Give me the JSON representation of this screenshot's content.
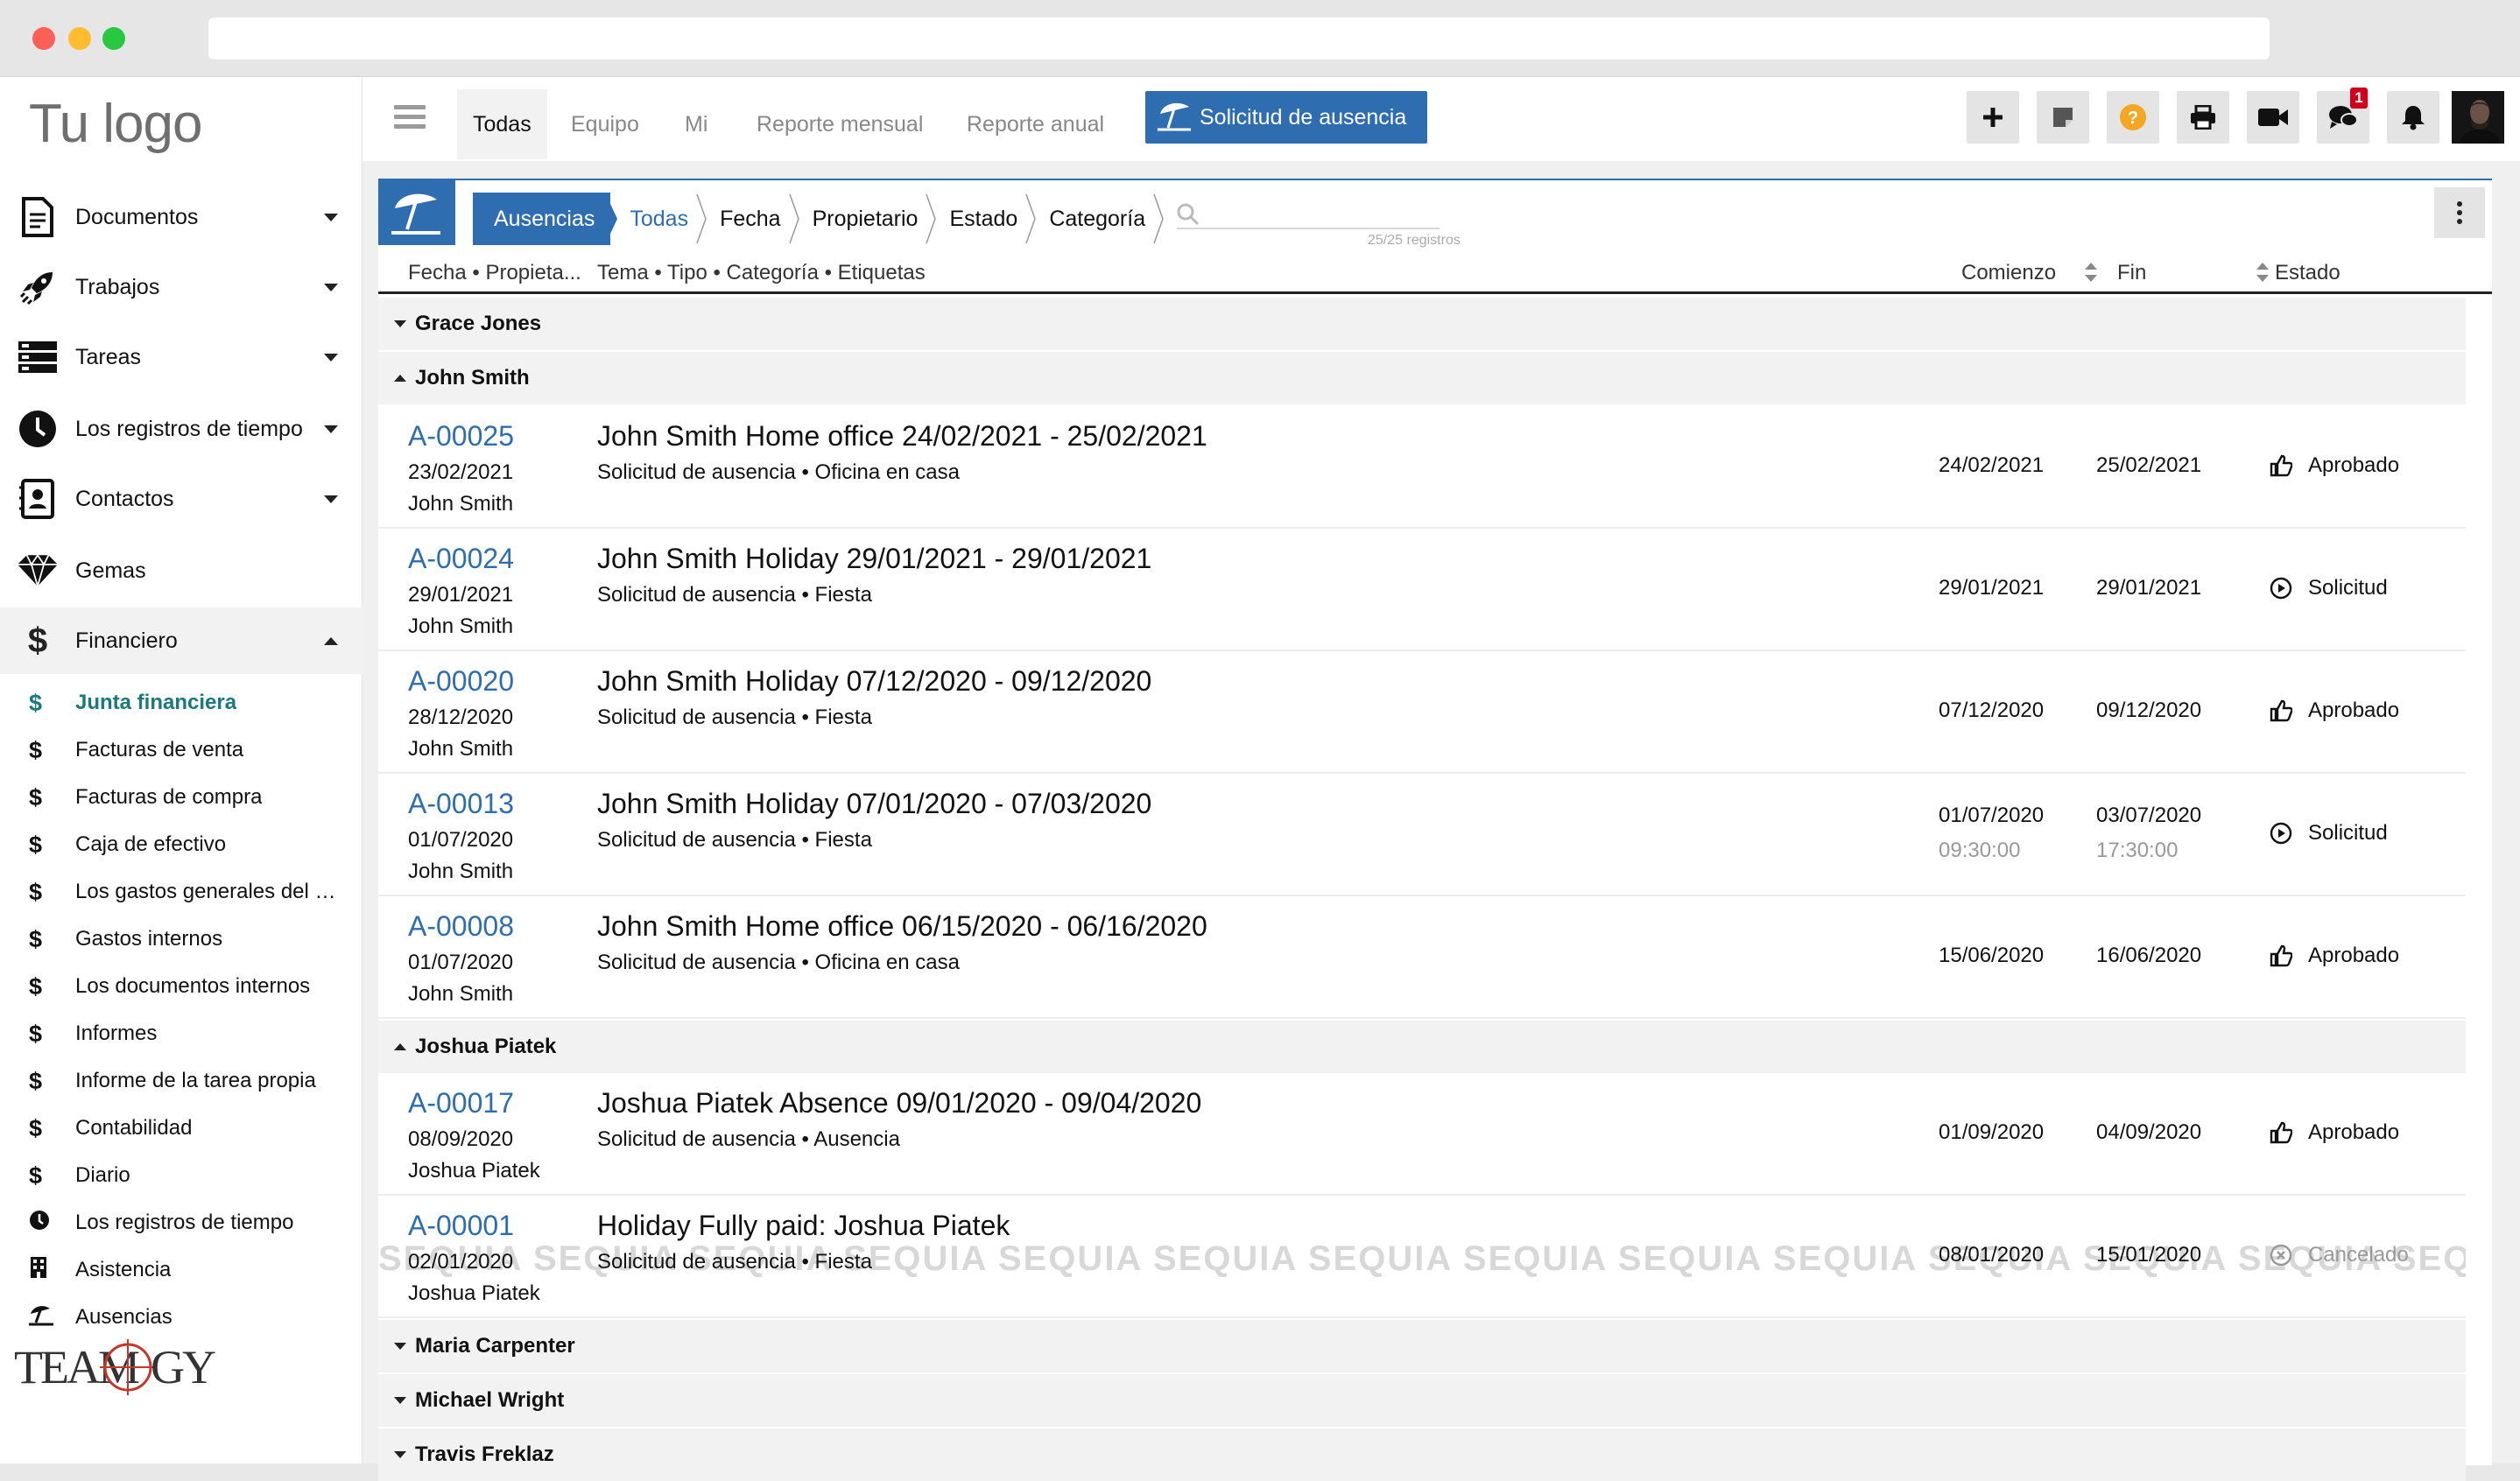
{
  "header": {
    "logo_text": "Tu logo"
  },
  "tabs": [
    {
      "label": "Todas",
      "active": true
    },
    {
      "label": "Equipo"
    },
    {
      "label": "Mi"
    },
    {
      "label": "Reporte mensual"
    },
    {
      "label": "Reporte anual"
    }
  ],
  "absence_button": "Solicitud de ausencia",
  "notification_badge": "1",
  "sidebar": {
    "items": [
      {
        "label": "Documentos"
      },
      {
        "label": "Trabajos"
      },
      {
        "label": "Tareas"
      },
      {
        "label": "Los registros de tiempo"
      },
      {
        "label": "Contactos"
      },
      {
        "label": "Gemas"
      },
      {
        "label": "Financiero"
      }
    ],
    "sub_items": [
      {
        "label": "Junta financiera"
      },
      {
        "label": "Facturas de venta"
      },
      {
        "label": "Facturas de compra"
      },
      {
        "label": "Caja de efectivo"
      },
      {
        "label": "Los gastos generales del …"
      },
      {
        "label": "Gastos internos"
      },
      {
        "label": "Los documentos internos"
      },
      {
        "label": "Informes"
      },
      {
        "label": "Informe de la tarea propia"
      },
      {
        "label": "Contabilidad"
      },
      {
        "label": "Diario"
      },
      {
        "label": "Los registros de tiempo"
      },
      {
        "label": "Asistencia"
      },
      {
        "label": "Ausencias"
      }
    ],
    "brand": "TEAMOGY"
  },
  "breadcrumb": [
    "Ausencias",
    "Todas",
    "Fecha",
    "Propietario",
    "Estado",
    "Categoría"
  ],
  "search": {
    "count": "25/25 registros"
  },
  "columns": {
    "left": "Fecha • Propieta...",
    "middle": "Tema • Tipo • Categoría • Etiquetas",
    "start": "Comienzo",
    "end": "Fin",
    "status": "Estado"
  },
  "groups": [
    {
      "name": "Grace Jones"
    },
    {
      "name": "John Smith"
    },
    {
      "name": "Joshua Piatek"
    },
    {
      "name": "Maria Carpenter"
    },
    {
      "name": "Michael Wright"
    },
    {
      "name": "Travis Freklaz"
    }
  ],
  "rows": [
    {
      "code": "A-00025",
      "date": "23/02/2021",
      "owner": "John Smith",
      "title": "John Smith Home office 24/02/2021 - 25/02/2021",
      "sub": "Solicitud de ausencia • Oficina en casa",
      "start": "24/02/2021",
      "end": "25/02/2021",
      "status": "Aprobado"
    },
    {
      "code": "A-00024",
      "date": "29/01/2021",
      "owner": "John Smith",
      "title": "John Smith Holiday 29/01/2021 - 29/01/2021",
      "sub": "Solicitud de ausencia • Fiesta",
      "start": "29/01/2021",
      "end": "29/01/2021",
      "status": "Solicitud"
    },
    {
      "code": "A-00020",
      "date": "28/12/2020",
      "owner": "John Smith",
      "title": "John Smith Holiday 07/12/2020 - 09/12/2020",
      "sub": "Solicitud de ausencia • Fiesta",
      "start": "07/12/2020",
      "end": "09/12/2020",
      "status": "Aprobado"
    },
    {
      "code": "A-00013",
      "date": "01/07/2020",
      "owner": "John Smith",
      "title": "John Smith Holiday 07/01/2020 - 07/03/2020",
      "sub": "Solicitud de ausencia • Fiesta",
      "start": "01/07/2020",
      "start_time": "09:30:00",
      "end": "03/07/2020",
      "end_time": "17:30:00",
      "status": "Solicitud"
    },
    {
      "code": "A-00008",
      "date": "01/07/2020",
      "owner": "John Smith",
      "title": "John Smith Home office 06/15/2020 - 06/16/2020",
      "sub": "Solicitud de ausencia • Oficina en casa",
      "start": "15/06/2020",
      "end": "16/06/2020",
      "status": "Aprobado"
    },
    {
      "code": "A-00017",
      "date": "08/09/2020",
      "owner": "Joshua Piatek",
      "title": "Joshua Piatek Absence 09/01/2020 - 09/04/2020",
      "sub": "Solicitud de ausencia • Ausencia",
      "start": "01/09/2020",
      "end": "04/09/2020",
      "status": "Aprobado"
    },
    {
      "code": "A-00001",
      "date": "02/01/2020",
      "owner": "Joshua Piatek",
      "title": "Holiday Fully paid: Joshua Piatek",
      "sub": "Solicitud de ausencia • Fiesta",
      "start": "08/01/2020",
      "end": "15/01/2020",
      "status": "Cancelado"
    }
  ],
  "watermark": "SEQUIA SEQUIA SEQUIA SEQUIA SEQUIA SEQUIA SEQUIA SEQUIA SEQUIA SEQUIA SEQUIA SEQUIA SEQUIA SEQUIA SEQUIA SEQUIA SEQUIA SEQUIA SEQUIA SEQUIA SEQUIA SEQUIA"
}
